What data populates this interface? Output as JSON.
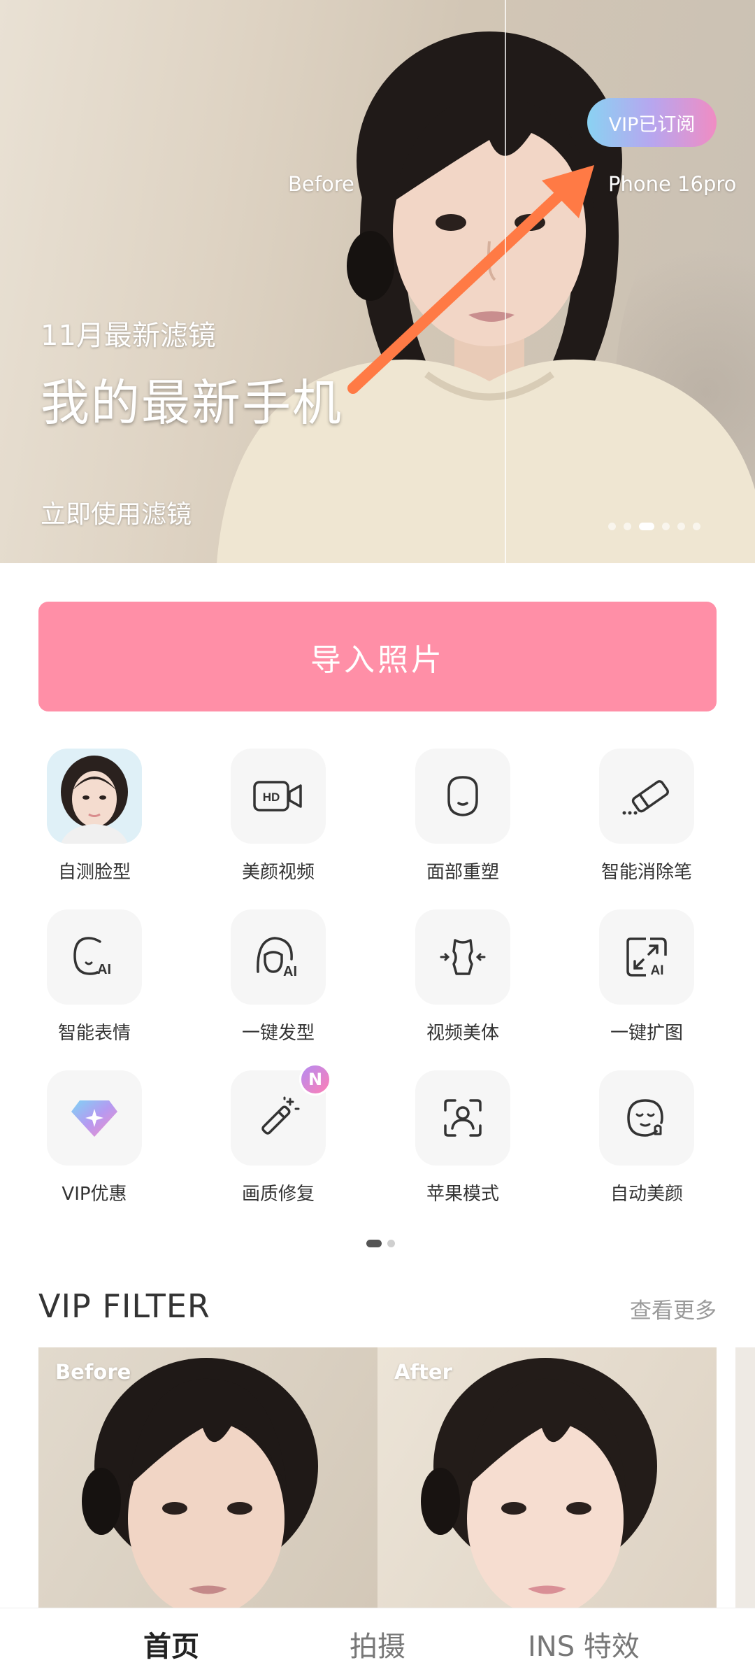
{
  "hero": {
    "before_label": "Before",
    "device_label": "Phone 16pro",
    "vip_badge": "VIP已订阅",
    "subtitle": "11月最新滤镜",
    "title": "我的最新手机",
    "cta": "立即使用滤镜",
    "carousel_count": 6,
    "carousel_active": 2
  },
  "import_button": "导入照片",
  "tools": [
    {
      "label": "自测脸型",
      "icon": "face-portrait-icon"
    },
    {
      "label": "美颜视频",
      "icon": "hd-video-icon"
    },
    {
      "label": "面部重塑",
      "icon": "face-outline-icon"
    },
    {
      "label": "智能消除笔",
      "icon": "eraser-icon"
    },
    {
      "label": "智能表情",
      "icon": "ai-face-icon"
    },
    {
      "label": "一键发型",
      "icon": "ai-hair-icon"
    },
    {
      "label": "视频美体",
      "icon": "body-shape-icon"
    },
    {
      "label": "一键扩图",
      "icon": "ai-expand-icon"
    },
    {
      "label": "VIP优惠",
      "icon": "diamond-icon"
    },
    {
      "label": "画质修复",
      "icon": "magic-wand-icon",
      "badge": "N"
    },
    {
      "label": "苹果模式",
      "icon": "face-scan-icon"
    },
    {
      "label": "自动美颜",
      "icon": "beauty-face-icon"
    }
  ],
  "grid_pages": {
    "count": 2,
    "active": 0
  },
  "vip_section": {
    "title": "VIP FILTER",
    "more": "查看更多",
    "before_tag": "Before",
    "after_tag": "After"
  },
  "nav": {
    "home": "首页",
    "camera": "拍摄",
    "effects": "INS 特效"
  },
  "colors": {
    "import_button": "#ff8fa7",
    "vip_gradient_start": "#8ad2f2",
    "vip_gradient_end": "#f08cc3",
    "arrow": "#ff7a45"
  }
}
